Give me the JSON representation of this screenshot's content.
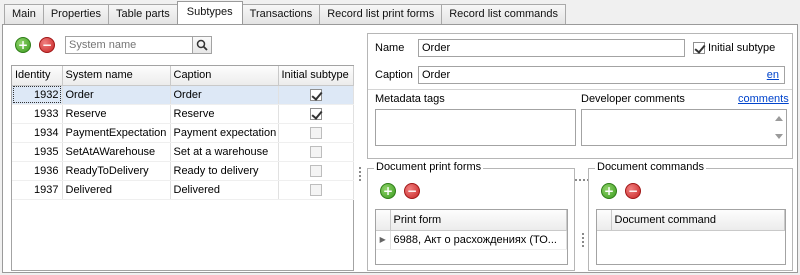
{
  "tabs": [
    "Main",
    "Properties",
    "Table parts",
    "Subtypes",
    "Transactions",
    "Record list print forms",
    "Record list commands"
  ],
  "active_tab": "Subtypes",
  "search": {
    "placeholder": "System name"
  },
  "grid": {
    "columns": [
      "Identity",
      "System name",
      "Caption",
      "Initial subtype"
    ],
    "rows": [
      {
        "id": "1932",
        "system_name": "Order",
        "caption": "Order",
        "initial": true
      },
      {
        "id": "1933",
        "system_name": "Reserve",
        "caption": "Reserve",
        "initial": true
      },
      {
        "id": "1934",
        "system_name": "PaymentExpectation",
        "caption": "Payment expectation",
        "initial": false
      },
      {
        "id": "1935",
        "system_name": "SetAtAWarehouse",
        "caption": "Set at a warehouse",
        "initial": false
      },
      {
        "id": "1936",
        "system_name": "ReadyToDelivery",
        "caption": "Ready to delivery",
        "initial": false
      },
      {
        "id": "1937",
        "system_name": "Delivered",
        "caption": "Delivered",
        "initial": false
      }
    ]
  },
  "details": {
    "name_label": "Name",
    "name_value": "Order",
    "initial_subtype_label": "Initial subtype",
    "initial_subtype_checked": true,
    "caption_label": "Caption",
    "caption_value": "Order",
    "lang_link": "en",
    "metadata_tags_label": "Metadata tags",
    "dev_comments_label": "Developer comments",
    "comments_link": "comments"
  },
  "print_forms": {
    "title": "Document print forms",
    "column": "Print form",
    "rows": [
      "6988, Акт о расхождениях (ТО..."
    ]
  },
  "commands": {
    "title": "Document commands",
    "column": "Document command",
    "rows": []
  },
  "icons": {
    "add": "add-icon",
    "delete": "delete-icon",
    "search": "search-icon"
  },
  "colors": {
    "selection": "#dde8f6",
    "link": "#0044cc",
    "add": "#3a9b1e",
    "delete": "#c82424"
  }
}
